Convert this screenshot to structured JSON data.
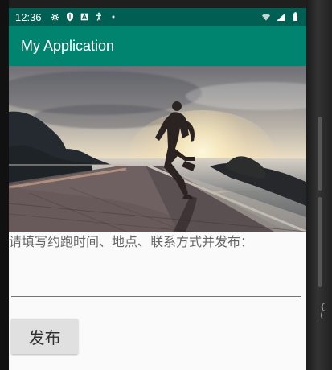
{
  "status_bar": {
    "time": "12:36",
    "left_icons": [
      "settings-icon",
      "shield-icon",
      "font-icon",
      "accessibility-icon",
      "dot-icon"
    ],
    "right_icons": [
      "wifi-icon",
      "signal-icon",
      "battery-icon"
    ],
    "color": "#005f52"
  },
  "app_bar": {
    "title": "My Application",
    "color": "#00846f"
  },
  "hero_image": {
    "subject": "runner-at-sunset",
    "icon": "runner-photo"
  },
  "form": {
    "instruction": "请填写约跑时间、地点、联系方式并发布：",
    "input_value": "",
    "input_placeholder": "",
    "button_label": "发布"
  },
  "colors": {
    "background": "#fafafa",
    "instruction_text": "#666666",
    "button_background": "#e0e0e0"
  }
}
